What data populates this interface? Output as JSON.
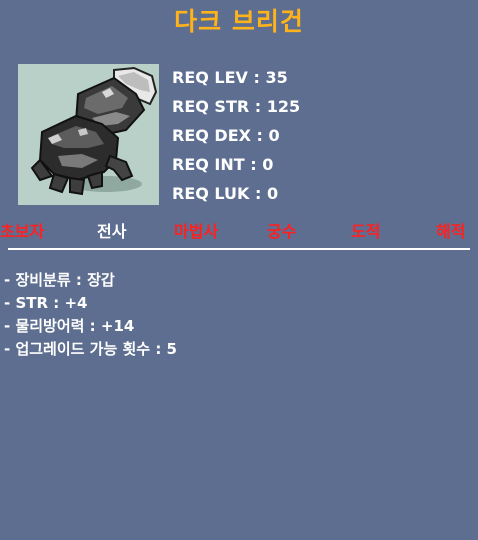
{
  "item": {
    "name": "다크 브리건",
    "icon": "dark-gauntlet-icon"
  },
  "requirements": [
    "REQ LEV : 35",
    "REQ STR : 125",
    "REQ DEX : 0",
    "REQ INT : 0",
    "REQ LUK : 0"
  ],
  "jobs": [
    {
      "label": "초보자",
      "allowed": false
    },
    {
      "label": "전사",
      "allowed": true
    },
    {
      "label": "마법사",
      "allowed": false
    },
    {
      "label": "궁수",
      "allowed": false
    },
    {
      "label": "도적",
      "allowed": false
    },
    {
      "label": "해적",
      "allowed": false
    }
  ],
  "stats": [
    "- 장비분류 : 장갑",
    "- STR : +4",
    "- 물리방어력 : +14",
    "- 업그레이드 가능 횟수 : 5"
  ],
  "colors": {
    "background": "#5d6e90",
    "title": "#ffb21a",
    "allowed": "#ffffff",
    "denied": "#ff2020"
  }
}
